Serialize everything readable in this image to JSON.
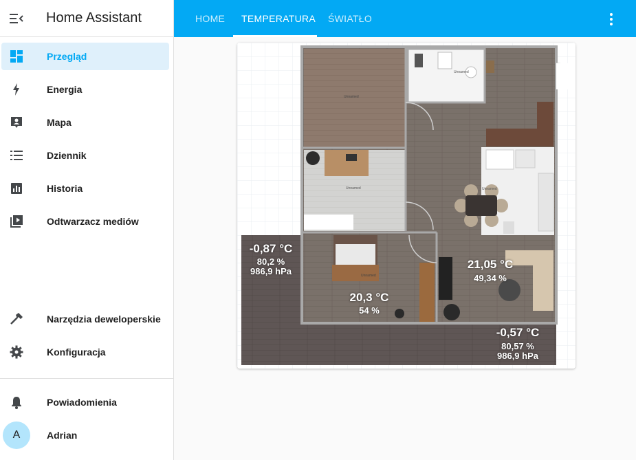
{
  "app": {
    "title": "Home Assistant"
  },
  "sidebar": {
    "items": [
      {
        "label": "Przegląd",
        "icon": "dashboard-icon",
        "active": true
      },
      {
        "label": "Energia",
        "icon": "lightning-icon"
      },
      {
        "label": "Mapa",
        "icon": "map-account-icon"
      },
      {
        "label": "Dziennik",
        "icon": "list-icon"
      },
      {
        "label": "Historia",
        "icon": "chart-bar-icon"
      },
      {
        "label": "Odtwarzacz mediów",
        "icon": "media-play-icon"
      }
    ],
    "bottom_items": [
      {
        "label": "Narzędzia deweloperskie",
        "icon": "hammer-icon"
      },
      {
        "label": "Konfiguracja",
        "icon": "gear-icon"
      }
    ],
    "notifications": {
      "label": "Powiadomienia",
      "icon": "bell-icon"
    },
    "user": {
      "initial": "A",
      "name": "Adrian"
    }
  },
  "topbar": {
    "tabs": [
      {
        "label": "HOME"
      },
      {
        "label": "TEMPERATURA",
        "active": true
      },
      {
        "label": "ŚWIATŁO"
      }
    ]
  },
  "floorplan": {
    "room_labels": [
      "Unnamed",
      "Unnamed",
      "Unnamed",
      "Unnamed",
      "Unnamed"
    ],
    "sensors": {
      "outside_left": {
        "temp": "-0,87 °C",
        "humidity": "80,2 %",
        "pressure": "986,9 hPa"
      },
      "bedroom": {
        "temp": "20,3 °C",
        "humidity": "54 %"
      },
      "living": {
        "temp": "21,05 °C",
        "humidity": "49,34 %"
      },
      "outside_right": {
        "temp": "-0,57 °C",
        "humidity": "80,57 %",
        "pressure": "986,9 hPa"
      }
    }
  },
  "colors": {
    "accent": "#03a9f4",
    "active_bg": "#dff0fb",
    "icon": "#44474a"
  }
}
